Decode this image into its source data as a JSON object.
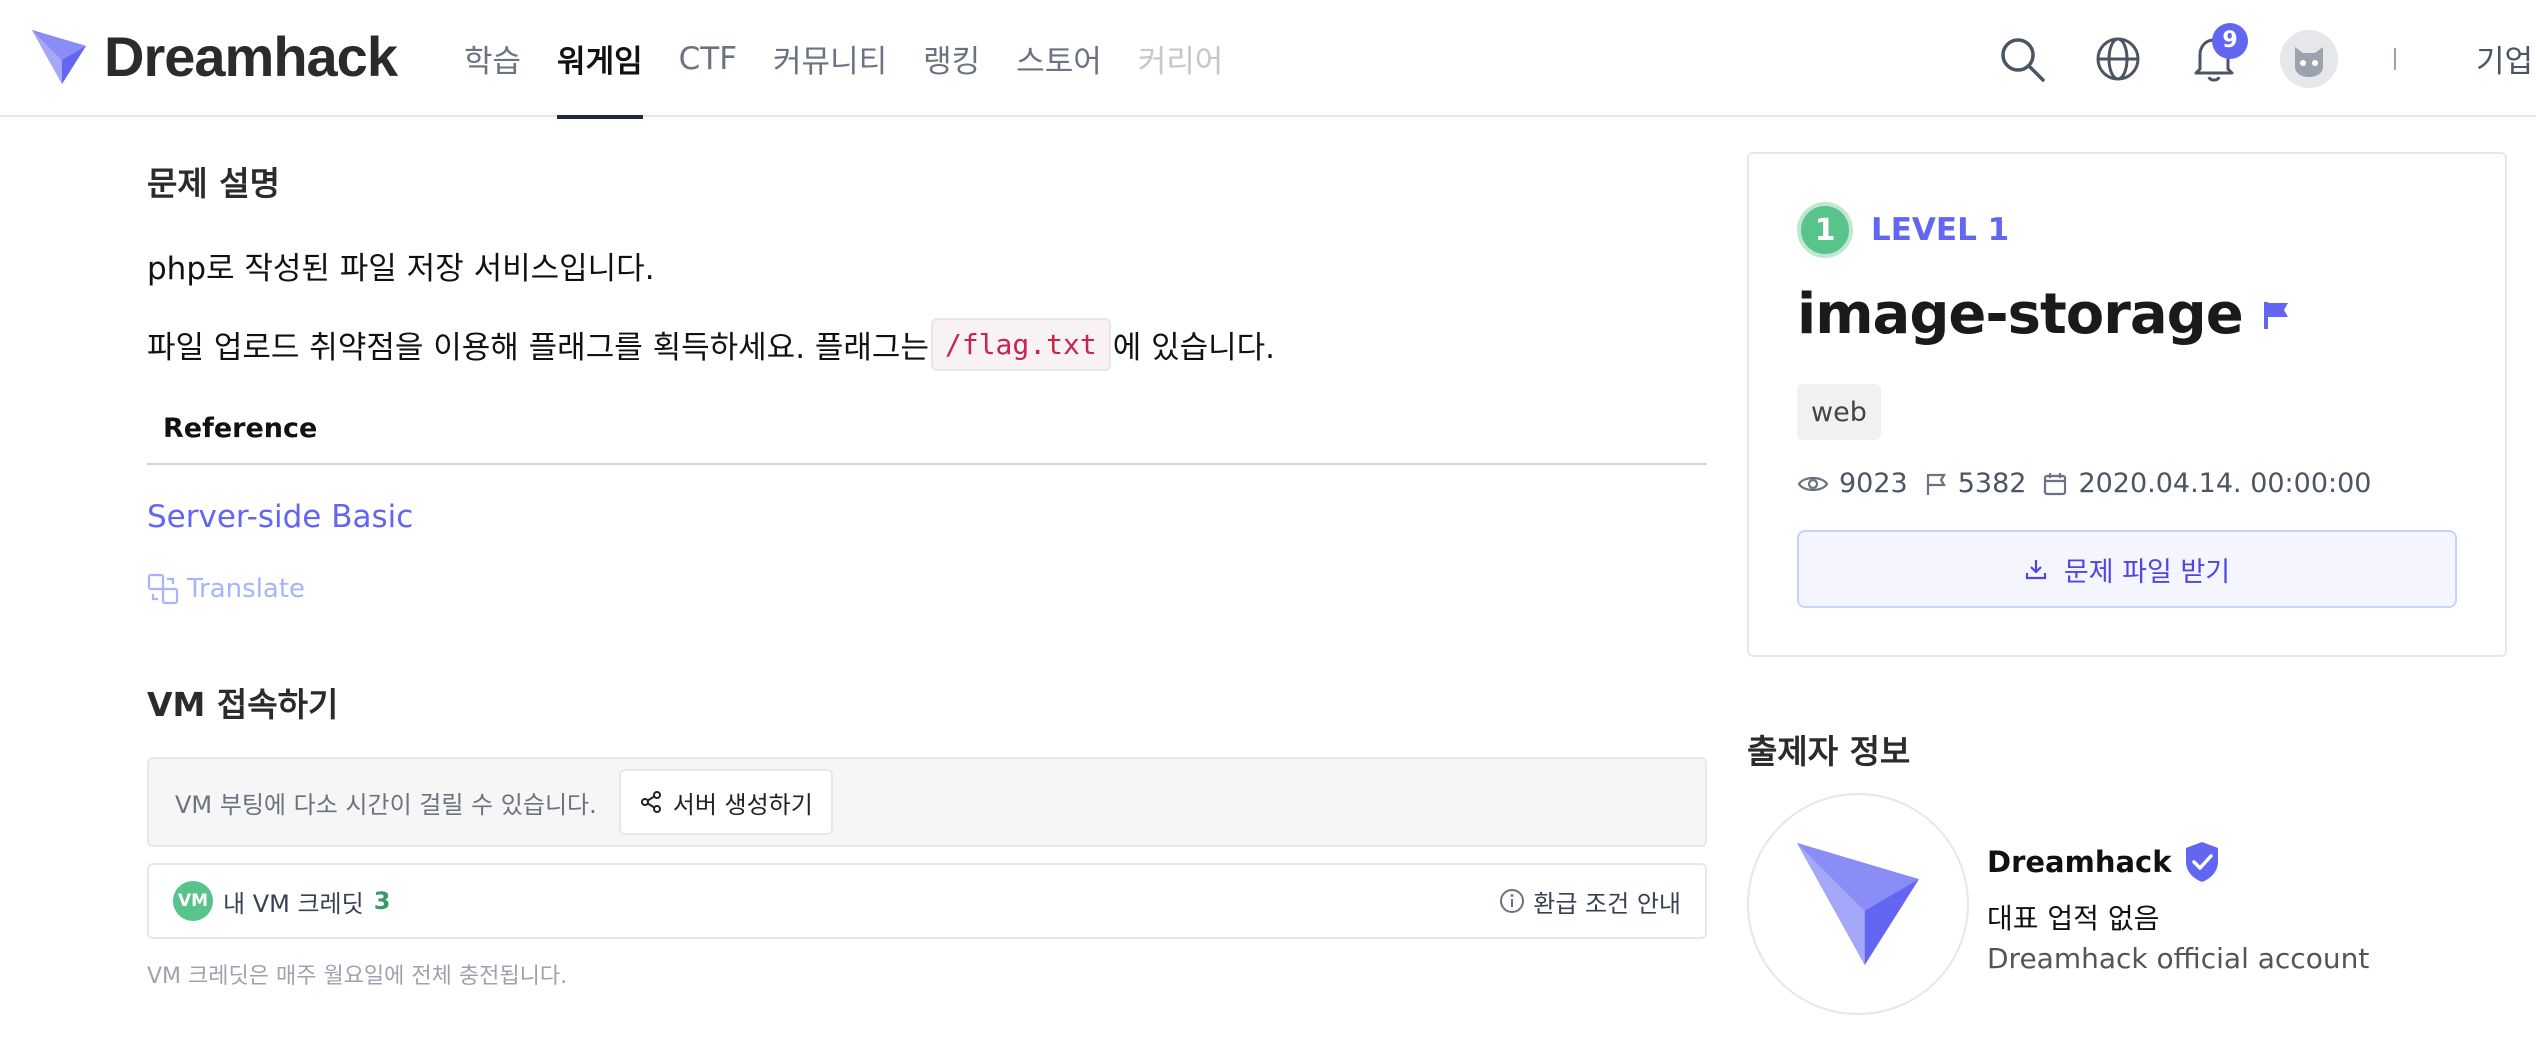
{
  "header": {
    "logo_text": "Dreamhack",
    "nav": [
      {
        "label": "학습"
      },
      {
        "label": "워게임"
      },
      {
        "label": "CTF"
      },
      {
        "label": "커뮤니티"
      },
      {
        "label": "랭킹"
      },
      {
        "label": "스토어"
      },
      {
        "label": "커리어"
      }
    ],
    "notification_count": "9",
    "company_label": "기업"
  },
  "description": {
    "title": "문제 설명",
    "line1": "php로 작성된 파일 저장 서비스입니다.",
    "line2_before": "파일 업로드 취약점을 이용해 플래그를 획득하세요. 플래그는 ",
    "line2_code": "/flag.txt",
    "line2_after": "에 있습니다.",
    "reference_header": "Reference",
    "reference_link": "Server-side Basic",
    "translate_label": "Translate"
  },
  "vm": {
    "title": "VM 접속하기",
    "boot_note": "VM 부팅에 다소 시간이 걸릴 수 있습니다.",
    "create_button": "서버 생성하기",
    "chip_label": "VM",
    "credit_label": "내 VM 크레딧",
    "credit_value": "3",
    "refund_label": "환급 조건 안내",
    "credit_note": "VM 크레딧은 매주 월요일에 전체 충전됩니다."
  },
  "challenge": {
    "level_number": "1",
    "level_label": "LEVEL 1",
    "name": "image-storage",
    "tag": "web",
    "views": "9023",
    "solves": "5382",
    "date": "2020.04.14. 00:00:00",
    "download_label": "문제 파일 받기"
  },
  "author": {
    "section_title": "출제자 정보",
    "name": "Dreamhack",
    "achievement": "대표 업적 없음",
    "description": "Dreamhack official account"
  },
  "colors": {
    "accent": "#6366f1",
    "level_green": "#59c38c",
    "code_red": "#c7254e"
  }
}
